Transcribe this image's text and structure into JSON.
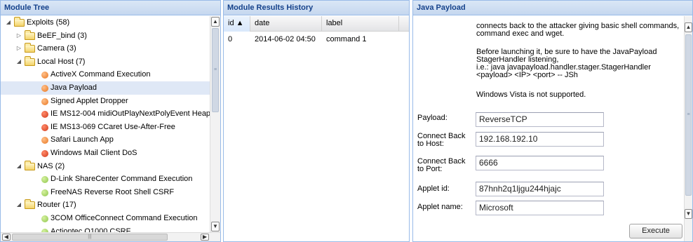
{
  "tree_panel": {
    "title": "Module Tree",
    "rows": [
      {
        "label": "Exploits (58)",
        "kind": "folder",
        "level": 0,
        "expanded": true
      },
      {
        "label": "BeEF_bind (3)",
        "kind": "folder",
        "level": 1,
        "expanded": false
      },
      {
        "label": "Camera (3)",
        "kind": "folder",
        "level": 1,
        "expanded": false
      },
      {
        "label": "Local Host (7)",
        "kind": "folder",
        "level": 1,
        "expanded": true
      },
      {
        "label": "ActiveX Command Execution",
        "kind": "module",
        "level": 2,
        "status": "orange"
      },
      {
        "label": "Java Payload",
        "kind": "module",
        "level": 2,
        "status": "orange",
        "selected": true
      },
      {
        "label": "Signed Applet Dropper",
        "kind": "module",
        "level": 2,
        "status": "orange"
      },
      {
        "label": "IE MS12-004 midiOutPlayNextPolyEvent Heap",
        "kind": "module",
        "level": 2,
        "status": "red"
      },
      {
        "label": "IE MS13-069 CCaret Use-After-Free",
        "kind": "module",
        "level": 2,
        "status": "red"
      },
      {
        "label": "Safari Launch App",
        "kind": "module",
        "level": 2,
        "status": "orange"
      },
      {
        "label": "Windows Mail Client DoS",
        "kind": "module",
        "level": 2,
        "status": "red"
      },
      {
        "label": "NAS (2)",
        "kind": "folder",
        "level": 1,
        "expanded": true
      },
      {
        "label": "D-Link ShareCenter Command Execution",
        "kind": "module",
        "level": 2,
        "status": "green"
      },
      {
        "label": "FreeNAS Reverse Root Shell CSRF",
        "kind": "module",
        "level": 2,
        "status": "green"
      },
      {
        "label": "Router (17)",
        "kind": "folder",
        "level": 1,
        "expanded": true
      },
      {
        "label": "3COM OfficeConnect Command Execution",
        "kind": "module",
        "level": 2,
        "status": "green"
      },
      {
        "label": "Actiontec Q1000 CSRF",
        "kind": "module",
        "level": 2,
        "status": "green"
      }
    ],
    "status_colors": {
      "orange": "#e8751e",
      "red": "#d0391a",
      "green": "#8cc44a"
    }
  },
  "history_panel": {
    "title": "Module Results History",
    "columns": [
      {
        "label": "id ▲",
        "sorted": true
      },
      {
        "label": "date"
      },
      {
        "label": "label"
      }
    ],
    "rows": [
      {
        "id": "0",
        "date": "2014-06-02 04:50",
        "label": "command 1"
      }
    ]
  },
  "payload_panel": {
    "title": "Java Payload",
    "description": [
      "connects back to the attacker giving basic shell commands,",
      "command exec and wget.",
      "Before launching it, be sure to have the JavaPayload",
      "StagerHandler listening,",
      "i.e.: java javapayload.handler.stager.StagerHandler",
      "<payload> <IP> <port> -- JSh",
      "Windows Vista is not supported."
    ],
    "fields": [
      {
        "label_lines": [
          "Payload:"
        ],
        "value": "ReverseTCP"
      },
      {
        "label_lines": [
          "Connect Back",
          "to Host:"
        ],
        "value": "192.168.192.10"
      },
      {
        "label_lines": [
          "Connect Back",
          "to Port:"
        ],
        "value": "6666"
      },
      {
        "label_lines": [
          "Applet id:"
        ],
        "value": "87hnh2q1ljgu244hjajc"
      },
      {
        "label_lines": [
          "Applet name:"
        ],
        "value": "Microsoft"
      }
    ],
    "execute_label": "Execute"
  },
  "theme": {
    "header_text": "#15428b",
    "header_border": "#99bbe8",
    "selected_row": "#dfe8f6"
  }
}
